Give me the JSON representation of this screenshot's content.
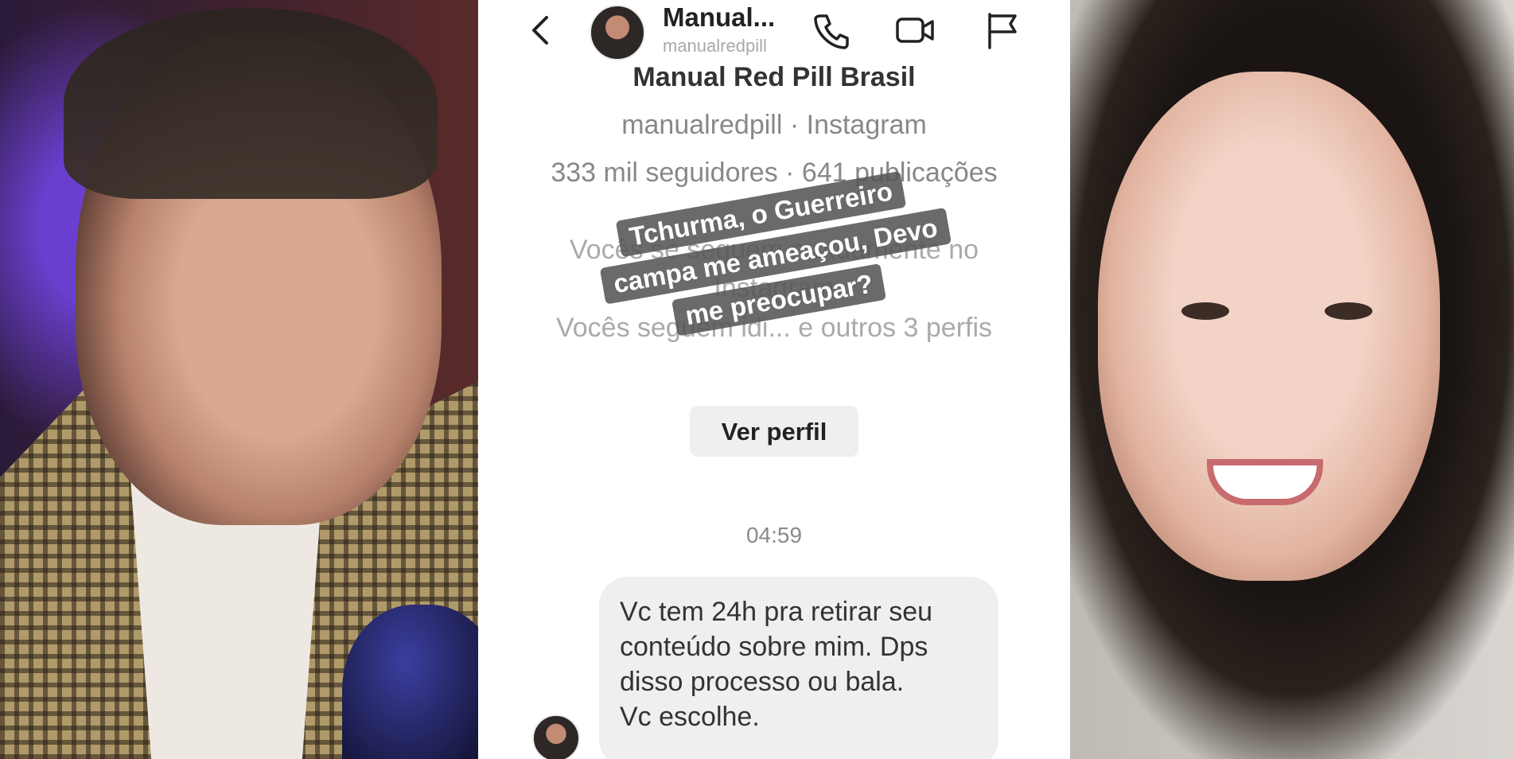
{
  "header": {
    "name": "Manual...",
    "username": "manualredpill",
    "icons": [
      "back-arrow-icon",
      "phone-icon",
      "video-camera-icon",
      "flag-icon"
    ]
  },
  "profile": {
    "name": "Manual Red Pill Brasil",
    "handle_line": "manualredpill · Instagram",
    "stats_line": "333 mil seguidores · 641 publicações",
    "mutual_line_1": "Vocês se seguem mutuamente no Instagram",
    "mutual_line_2": "Vocês seguem idi... e outros 3 perfis",
    "view_profile_label": "Ver perfil"
  },
  "overlay_text": {
    "line1": "Tchurma, o Guerreiro",
    "line2": "campa me ameaçou, Devo",
    "line3": "me preocupar?"
  },
  "chat": {
    "timestamp": "04:59",
    "message": "Vc tem 24h pra retirar seu\nconteúdo sobre mim. Dps\ndisso processo ou bala.\nVc escolhe."
  },
  "colors": {
    "overlay_bg": "#555555",
    "bubble_bg": "#efefef",
    "button_bg": "#efefef"
  }
}
